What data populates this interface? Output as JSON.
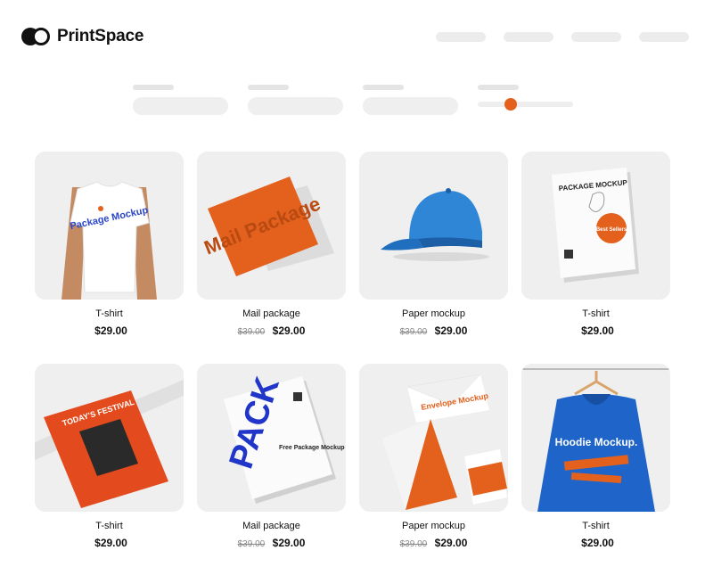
{
  "header": {
    "brand": "PrintSpace",
    "nav": [
      "",
      "",
      "",
      ""
    ]
  },
  "colors": {
    "accent": "#e3611c",
    "placeholder": "#efefef",
    "text": "#111111"
  },
  "filters": {
    "price_range_level": 0.35
  },
  "products": [
    {
      "title": "T-shirt",
      "old_price": "",
      "price": "$29.00",
      "image": "tshirt-mockup"
    },
    {
      "title": "Mail package",
      "old_price": "$39.00",
      "price": "$29.00",
      "image": "mail-package-mockup"
    },
    {
      "title": "Paper mockup",
      "old_price": "$39.00",
      "price": "$29.00",
      "image": "cap-mockup"
    },
    {
      "title": "T-shirt",
      "old_price": "",
      "price": "$29.00",
      "image": "package-mockup"
    },
    {
      "title": "T-shirt",
      "old_price": "",
      "price": "$29.00",
      "image": "poster-mockup"
    },
    {
      "title": "Mail package",
      "old_price": "$39.00",
      "price": "$29.00",
      "image": "pack-mockup"
    },
    {
      "title": "Paper mockup",
      "old_price": "$39.00",
      "price": "$29.00",
      "image": "envelope-mockup"
    },
    {
      "title": "T-shirt",
      "old_price": "",
      "price": "$29.00",
      "image": "hoodie-mockup"
    }
  ],
  "image_text": {
    "tshirt": "Package Mockup",
    "mail": "Mail Package",
    "package_card": "PACKAGE MOCKUP",
    "badge": "Best Sellers",
    "poster_title": "TODAY'S FESTIVAL",
    "pack_big": "PACK",
    "pack_small": "Free Package Mockup",
    "envelope": "Envelope Mockup",
    "hoodie": "Hoodie Mockup."
  }
}
